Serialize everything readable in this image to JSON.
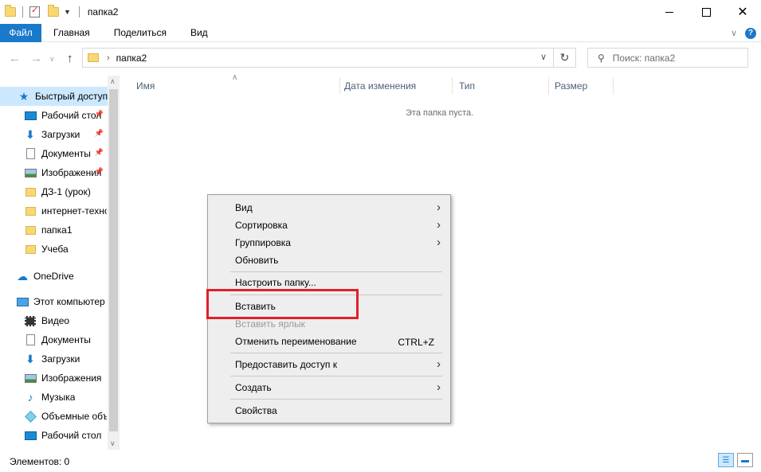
{
  "window": {
    "title": "папка2"
  },
  "ribbon": {
    "tabs": [
      "Файл",
      "Главная",
      "Поделиться",
      "Вид"
    ]
  },
  "address": {
    "path": "папка2",
    "search_placeholder": "Поиск: папка2"
  },
  "navpane": {
    "quick_access": "Быстрый доступ",
    "items": [
      {
        "label": "Рабочий стол",
        "icon": "desktop-icon",
        "pinned": true
      },
      {
        "label": "Загрузки",
        "icon": "download-icon",
        "pinned": true
      },
      {
        "label": "Документы",
        "icon": "documents-icon",
        "pinned": true
      },
      {
        "label": "Изображения",
        "icon": "pictures-icon",
        "pinned": true
      },
      {
        "label": "ДЗ-1 (урок)",
        "icon": "folder-icon",
        "pinned": false
      },
      {
        "label": "интернет-технологии",
        "icon": "folder-icon",
        "pinned": false
      },
      {
        "label": "папка1",
        "icon": "folder-icon",
        "pinned": false
      },
      {
        "label": "Учеба",
        "icon": "folder-icon",
        "pinned": false
      }
    ],
    "onedrive": "OneDrive",
    "this_pc": "Этот компьютер",
    "pc_items": [
      {
        "label": "Видео",
        "icon": "video-icon"
      },
      {
        "label": "Документы",
        "icon": "documents-icon"
      },
      {
        "label": "Загрузки",
        "icon": "download-icon"
      },
      {
        "label": "Изображения",
        "icon": "pictures-icon"
      },
      {
        "label": "Музыка",
        "icon": "music-icon"
      },
      {
        "label": "Объемные объекты",
        "icon": "3d-objects-icon"
      },
      {
        "label": "Рабочий стол",
        "icon": "desktop-icon"
      }
    ]
  },
  "list": {
    "columns": [
      "Имя",
      "Дата изменения",
      "Тип",
      "Размер"
    ],
    "empty_message": "Эта папка пуста."
  },
  "context_menu": {
    "items": {
      "view": "Вид",
      "sort": "Сортировка",
      "group": "Группировка",
      "refresh": "Обновить",
      "customize": "Настроить папку...",
      "paste": "Вставить",
      "paste_shortcut": "Вставить ярлык",
      "undo_rename": "Отменить переименование",
      "undo_shortcut": "CTRL+Z",
      "share": "Предоставить доступ к",
      "new": "Создать",
      "properties": "Свойства"
    },
    "highlight_color": "#e0202a"
  },
  "status": {
    "items_count": "Элементов: 0"
  },
  "colors": {
    "accent": "#1979ca",
    "selected_bg": "#cce8ff"
  }
}
